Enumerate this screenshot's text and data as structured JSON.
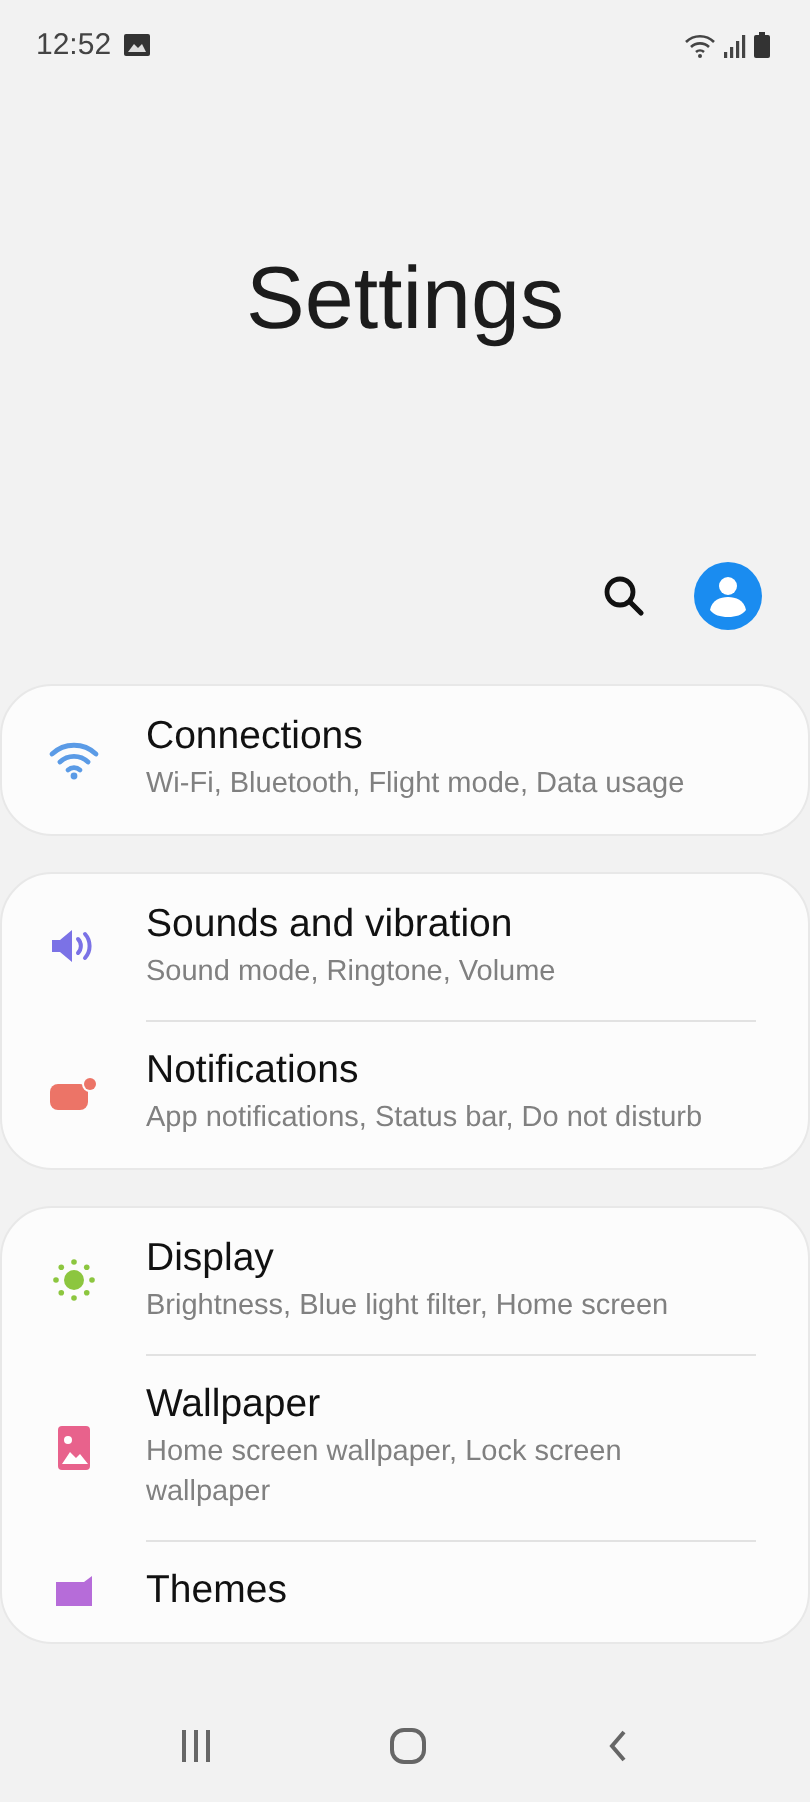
{
  "status_bar": {
    "time": "12:52"
  },
  "title": "Settings",
  "groups": [
    {
      "items": [
        {
          "kind": "wifi",
          "color": "#5b9be6",
          "title": "Connections",
          "subtitle": "Wi-Fi, Bluetooth, Flight mode, Data usage"
        }
      ]
    },
    {
      "items": [
        {
          "kind": "sound",
          "color": "#7b72e6",
          "title": "Sounds and vibration",
          "subtitle": "Sound mode, Ringtone, Volume"
        },
        {
          "kind": "notification",
          "color": "#ec7467",
          "title": "Notifications",
          "subtitle": "App notifications, Status bar, Do not disturb"
        }
      ]
    },
    {
      "items": [
        {
          "kind": "display",
          "color": "#8cc63f",
          "title": "Display",
          "subtitle": "Brightness, Blue light filter, Home screen"
        },
        {
          "kind": "wallpaper",
          "color": "#e8628c",
          "title": "Wallpaper",
          "subtitle": "Home screen wallpaper, Lock screen wallpaper"
        },
        {
          "kind": "themes",
          "color": "#b66cd9",
          "title": "Themes"
        }
      ]
    }
  ]
}
